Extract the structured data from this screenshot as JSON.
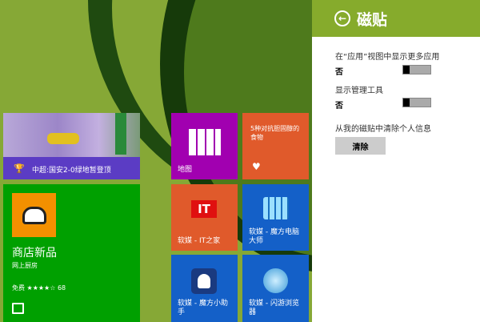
{
  "panel": {
    "title": "磁贴",
    "settings": [
      {
        "label": "在“应用”视图中显示更多应用",
        "value": "否"
      },
      {
        "label": "显示管理工具",
        "value": "否"
      }
    ],
    "clear_label": "从我的磁贴中清除个人信息",
    "clear_button": "清除"
  },
  "tiles": {
    "news": {
      "headline": "中超:国安2-0绿地暂登顶",
      "color": "#5b3cc4"
    },
    "store": {
      "title": "商店新品",
      "app": "网上厨房",
      "rating": "免费 ★★★★☆ 68",
      "color": "#00a000"
    },
    "maps": {
      "label": "地图",
      "color": "#a100b0"
    },
    "health": {
      "text": "5种对抗胆固醇的食物",
      "color": "#e05a2b"
    },
    "ithome": {
      "label": "软媒 - IT之家",
      "icon_text": "IT",
      "color": "#e05a2b"
    },
    "mofang_master": {
      "label": "软媒 - 魔方电脑大师",
      "color": "#1460c8"
    },
    "mofang_helper": {
      "label": "软媒 - 魔方小助手",
      "color": "#1460c8"
    },
    "browser": {
      "label": "软媒 - 闪游浏览器",
      "color": "#1460c8"
    }
  }
}
